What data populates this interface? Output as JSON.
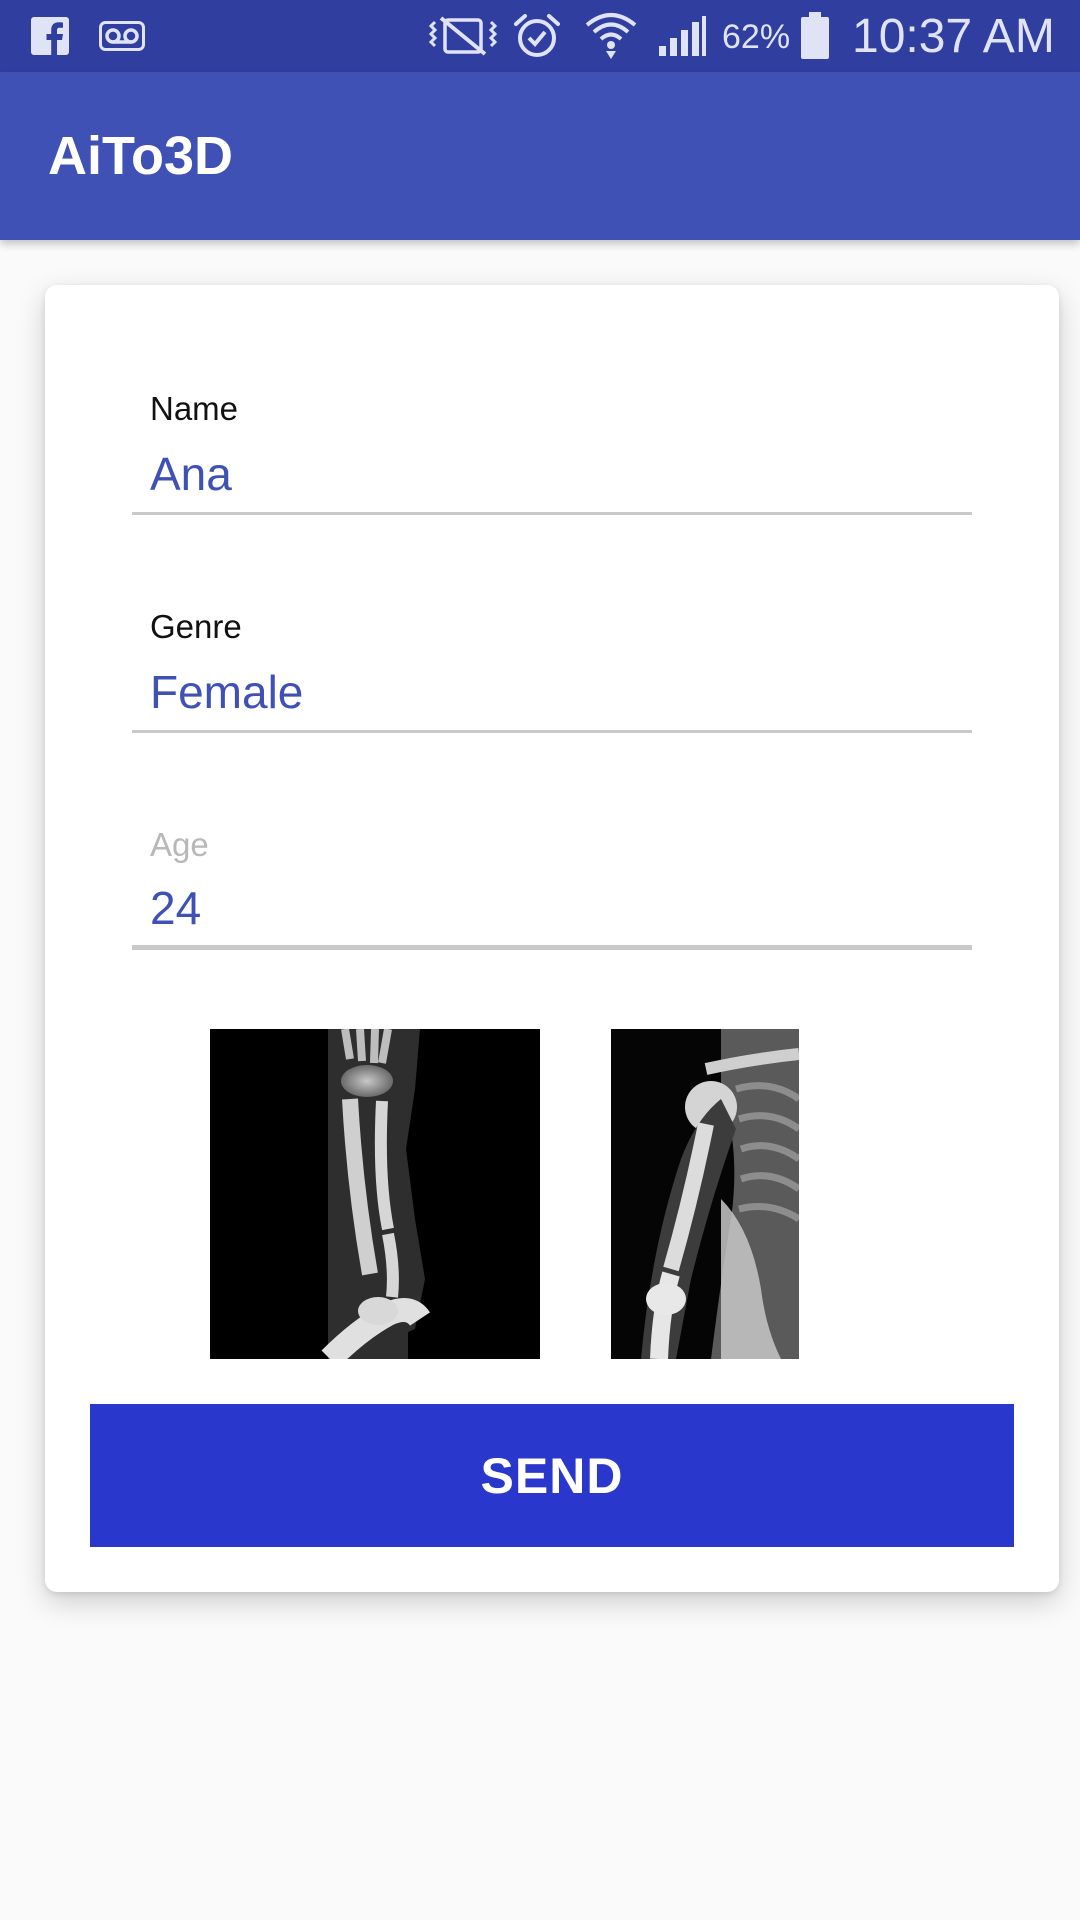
{
  "status_bar": {
    "icons": [
      "facebook-icon",
      "voicemail-icon",
      "vibrate-icon",
      "alarm-icon",
      "wifi-icon",
      "signal-icon",
      "battery-icon"
    ],
    "battery_percent": "62%",
    "time": "10:37 AM"
  },
  "app_bar": {
    "title": "AiTo3D"
  },
  "form": {
    "name": {
      "label": "Name",
      "value": "Ana"
    },
    "genre": {
      "label": "Genre",
      "value": "Female"
    },
    "age": {
      "label": "Age",
      "value": "24"
    }
  },
  "images": [
    "forearm-xray-image",
    "shoulder-xray-image"
  ],
  "send_button": {
    "label": "SEND"
  },
  "colors": {
    "status_bar": "#303f9f",
    "app_bar": "#3f51b5",
    "accent_text": "#3f51b5",
    "send_button": "#2937cc",
    "background": "#fafafa"
  }
}
